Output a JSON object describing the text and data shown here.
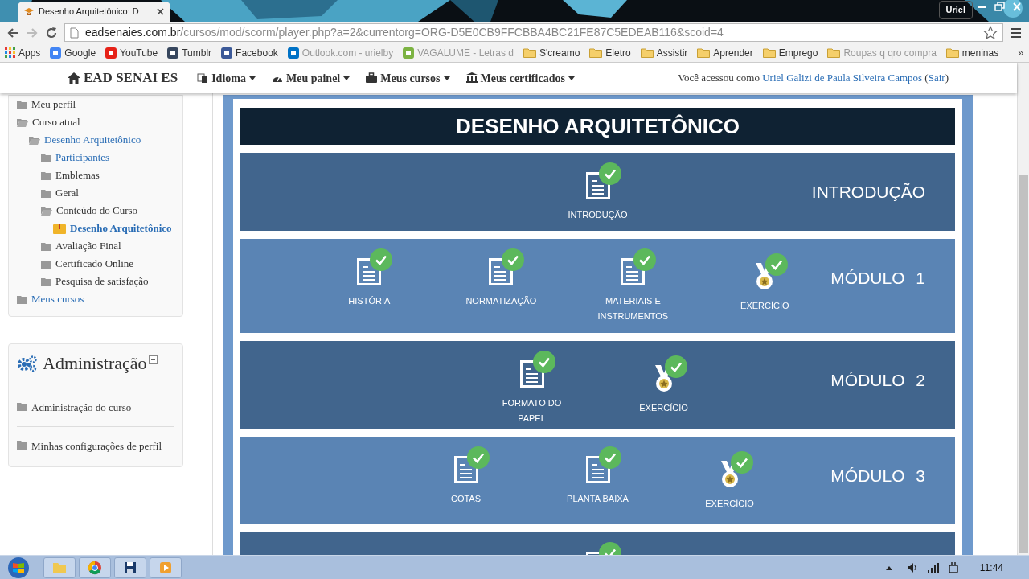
{
  "browser": {
    "tab": {
      "title": "Desenho Arquitetônico: D"
    },
    "profile": "Uriel",
    "url": {
      "host": "eadsenaies.com.br",
      "path": "/cursos/mod/scorm/player.php?a=2&currentorg=ORG-D5E0CB9FFCBBA4BC21FE87C5EDEAB116&scoid=4"
    },
    "bookmarks": [
      {
        "kind": "apps",
        "label": "Apps",
        "faded": false
      },
      {
        "kind": "site",
        "label": "Google",
        "color": "#4285f4",
        "faded": false
      },
      {
        "kind": "site",
        "label": "YouTube",
        "color": "#e62117",
        "faded": false
      },
      {
        "kind": "site",
        "label": "Tumblr",
        "color": "#36465d",
        "faded": false
      },
      {
        "kind": "site",
        "label": "Facebook",
        "color": "#3b5998",
        "faded": false
      },
      {
        "kind": "site",
        "label": "Outlook.com - urielby",
        "color": "#0072c6",
        "faded": true
      },
      {
        "kind": "site",
        "label": "VAGALUME - Letras d",
        "color": "#7cb342",
        "faded": true
      },
      {
        "kind": "folder",
        "label": "S'creamo",
        "faded": false
      },
      {
        "kind": "folder",
        "label": "Eletro",
        "faded": false
      },
      {
        "kind": "folder",
        "label": "Assistir",
        "faded": false
      },
      {
        "kind": "folder",
        "label": "Aprender",
        "faded": false
      },
      {
        "kind": "folder",
        "label": "Emprego",
        "faded": false
      },
      {
        "kind": "folder",
        "label": "Roupas q qro compra",
        "faded": true
      },
      {
        "kind": "folder",
        "label": "meninas",
        "faded": false
      }
    ],
    "more": "»"
  },
  "navbar": {
    "brand": "EAD SENAI ES",
    "menus": [
      {
        "kind": "language",
        "label": "Idioma"
      },
      {
        "kind": "dashboard",
        "label": "Meu painel"
      },
      {
        "kind": "courses",
        "label": "Meus cursos"
      },
      {
        "kind": "certificates",
        "label": "Meus certificados"
      }
    ],
    "login": {
      "prefix": "Você acessou como ",
      "user": "Uriel Galizi de Paula Silveira Campos",
      "open": " (",
      "logout": "Sair",
      "close": ")"
    }
  },
  "navigation": {
    "items": [
      {
        "label": "Meu perfil",
        "kind": "folder",
        "link": false,
        "expanded": false
      },
      {
        "label": "Curso atual",
        "kind": "folder",
        "link": false,
        "expanded": true,
        "children": [
          {
            "label": "Desenho Arquitetônico",
            "kind": "folder",
            "link": true,
            "expanded": true,
            "children": [
              {
                "label": "Participantes",
                "kind": "folder",
                "link": true,
                "expanded": false
              },
              {
                "label": "Emblemas",
                "kind": "folder",
                "link": false,
                "expanded": false
              },
              {
                "label": "Geral",
                "kind": "folder",
                "link": false,
                "expanded": false
              },
              {
                "label": "Conteúdo do Curso",
                "kind": "folder",
                "link": false,
                "expanded": true,
                "children": [
                  {
                    "label": "Desenho Arquitetônico",
                    "kind": "activity",
                    "link": true
                  }
                ]
              },
              {
                "label": "Avaliação Final",
                "kind": "folder",
                "link": false,
                "expanded": false
              },
              {
                "label": "Certificado Online",
                "kind": "folder",
                "link": false,
                "expanded": false
              },
              {
                "label": "Pesquisa de satisfação",
                "kind": "folder",
                "link": false,
                "expanded": false
              }
            ]
          }
        ]
      },
      {
        "label": "Meus cursos",
        "kind": "folder",
        "link": true,
        "expanded": false
      }
    ]
  },
  "administration": {
    "title": "Administração",
    "items": [
      "Administração do curso",
      "Minhas configurações de perfil"
    ]
  },
  "course": {
    "title": "DESENHO ARQUITETÔNICO",
    "sections": [
      {
        "title": "INTRODUÇÃO",
        "color": "#41658d",
        "items": [
          {
            "kind": "doc",
            "label": "INTRODUÇÃO",
            "completed": true
          }
        ]
      },
      {
        "title": "MÓDULO 1",
        "color": "#5a84b4",
        "items": [
          {
            "kind": "doc",
            "label": "HISTÓRIA",
            "completed": true
          },
          {
            "kind": "doc",
            "label": "NORMATIZAÇÃO",
            "completed": true
          },
          {
            "kind": "doc",
            "label": "MATERIAIS E INSTRUMENTOS",
            "completed": true
          },
          {
            "kind": "medal",
            "label": "EXERCÍCIO",
            "completed": true
          }
        ]
      },
      {
        "title": "MÓDULO 2",
        "color": "#41658d",
        "items": [
          {
            "kind": "doc",
            "label": "FORMATO DO PAPEL",
            "completed": true
          },
          {
            "kind": "medal",
            "label": "EXERCÍCIO",
            "completed": true
          }
        ]
      },
      {
        "title": "MÓDULO 3",
        "color": "#5a84b4",
        "items": [
          {
            "kind": "doc",
            "label": "COTAS",
            "completed": true
          },
          {
            "kind": "doc",
            "label": "PLANTA BAIXA",
            "completed": true
          },
          {
            "kind": "medal",
            "label": "EXERCÍCIO",
            "completed": true
          }
        ]
      },
      {
        "color": "#41658d",
        "items": [
          {
            "kind": "doc",
            "completed": true
          }
        ]
      }
    ]
  },
  "taskbar": {
    "apps": [
      {
        "kind": "explorer"
      },
      {
        "kind": "chrome"
      },
      {
        "kind": "disk"
      },
      {
        "kind": "media"
      }
    ],
    "clock": "11:44"
  }
}
